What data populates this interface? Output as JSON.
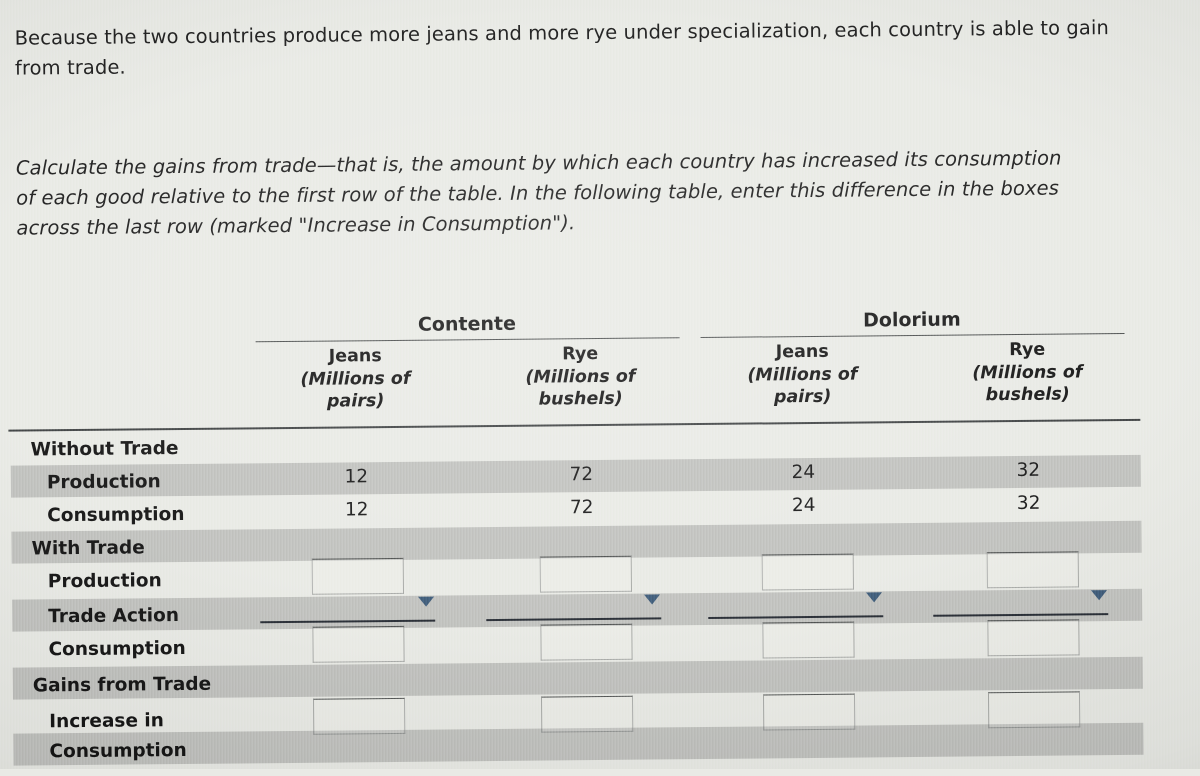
{
  "prose": {
    "paragraph_1": "Because the two countries produce more jeans and more rye under specialization, each country is able to gain from trade.",
    "paragraph_2": "Calculate the gains from trade—that is, the amount by which each country has increased its consumption of each good relative to the first row of the table. In the following table, enter this difference in the boxes across the last row (marked \"Increase in Consumption\")."
  },
  "table": {
    "country_groups": [
      {
        "name": "Contente"
      },
      {
        "name": "Dolorium"
      }
    ],
    "columns": [
      {
        "good": "Jeans",
        "unit_line1": "(Millions of",
        "unit_line2": "pairs)"
      },
      {
        "good": "Rye",
        "unit_line1": "(Millions of",
        "unit_line2": "bushels)"
      },
      {
        "good": "Jeans",
        "unit_line1": "(Millions of",
        "unit_line2": "pairs)"
      },
      {
        "good": "Rye",
        "unit_line1": "(Millions of",
        "unit_line2": "bushels)"
      }
    ],
    "rows": [
      {
        "label": "Without Trade",
        "type": "section",
        "indent": 0
      },
      {
        "label": "Production",
        "type": "values",
        "indent": 1,
        "values": [
          "12",
          "72",
          "24",
          "32"
        ]
      },
      {
        "label": "Consumption",
        "type": "values",
        "indent": 1,
        "values": [
          "12",
          "72",
          "24",
          "32"
        ]
      },
      {
        "label": "With Trade",
        "type": "section",
        "indent": 0
      },
      {
        "label": "Production",
        "type": "inputs",
        "indent": 1,
        "values": [
          "",
          "",
          "",
          ""
        ]
      },
      {
        "label": "Trade Action",
        "type": "selects",
        "indent": 1,
        "values": [
          "",
          "",
          "",
          ""
        ]
      },
      {
        "label": "Consumption",
        "type": "inputs",
        "indent": 1,
        "values": [
          "",
          "",
          "",
          ""
        ]
      },
      {
        "label": "Gains from Trade",
        "type": "section",
        "indent": 0
      },
      {
        "label": "Increase in Consumption",
        "type": "inputs",
        "indent": 1,
        "values": [
          "",
          "",
          "",
          ""
        ]
      }
    ]
  },
  "colors": {
    "page_background": "#e9eae5",
    "stripe": "#b0b2ae",
    "rule": "#3e4142",
    "text": "#171717",
    "dropdown_caret": "#3d5a78",
    "select_underline": "#262b33"
  }
}
